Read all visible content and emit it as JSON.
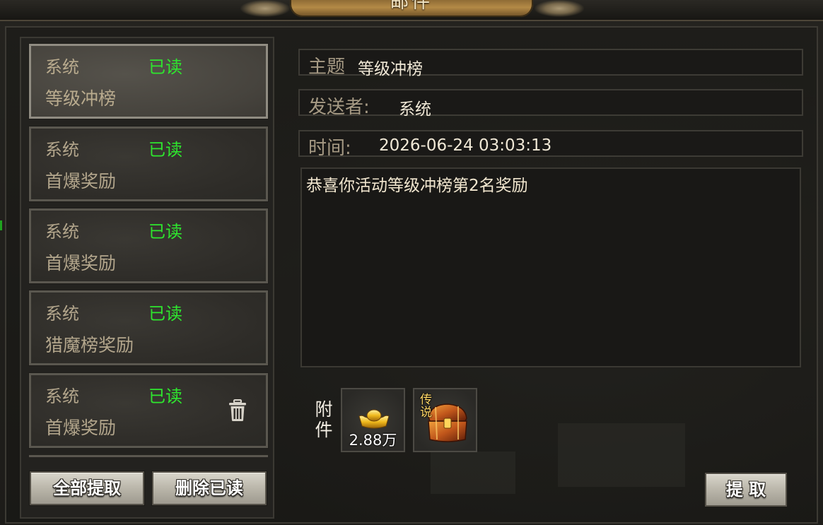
{
  "window": {
    "title": "邮件"
  },
  "mail_list": [
    {
      "sender": "系统",
      "status": "已读",
      "subject": "等级冲榜",
      "selected": true
    },
    {
      "sender": "系统",
      "status": "已读",
      "subject": "首爆奖励",
      "selected": false
    },
    {
      "sender": "系统",
      "status": "已读",
      "subject": "首爆奖励",
      "selected": false
    },
    {
      "sender": "系统",
      "status": "已读",
      "subject": "猎魔榜奖励",
      "selected": false
    },
    {
      "sender": "系统",
      "status": "已读",
      "subject": "首爆奖励",
      "selected": false,
      "has_trash_icon": true
    }
  ],
  "buttons": {
    "claim_all": "全部提取",
    "delete_read": "删除已读",
    "claim": "提 取"
  },
  "detail": {
    "subject_label": "主题",
    "subject_value": "等级冲榜",
    "sender_label": "发送者:",
    "sender_value": "系统",
    "time_label": "时间:",
    "time_value": "2026-06-24 03:03:13",
    "body": "恭喜你活动等级冲榜第2名奖励"
  },
  "attachments": {
    "label": "附件",
    "items": [
      {
        "icon": "gold-ingot-icon",
        "quantity": "2.88万"
      },
      {
        "icon": "legendary-chest-icon",
        "tag": "传说"
      }
    ]
  },
  "colors": {
    "read_status": "#2ee62e",
    "text_muted": "#b3a68c",
    "text_bright": "#f0e8d6",
    "title_gold": "#b48a46"
  }
}
